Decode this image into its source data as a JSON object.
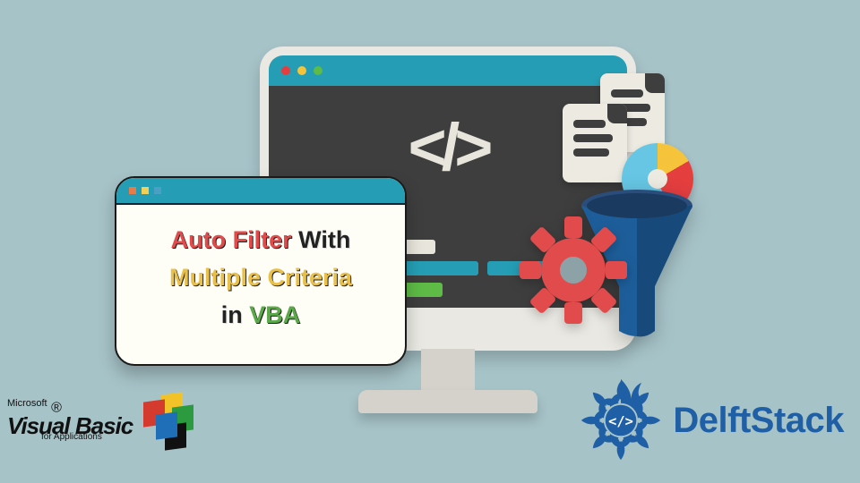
{
  "title_card": {
    "auto_filter": "Auto Filter",
    "with": "With",
    "multiple_criteria": "Multiple Criteria",
    "in": "in",
    "vba": "VBA"
  },
  "monitor": {
    "code_glyph": "</>"
  },
  "logos": {
    "microsoft": "Microsoft",
    "visual_basic": "Visual Basic",
    "for_applications": "for Applications",
    "delftstack": "DelftStack"
  }
}
